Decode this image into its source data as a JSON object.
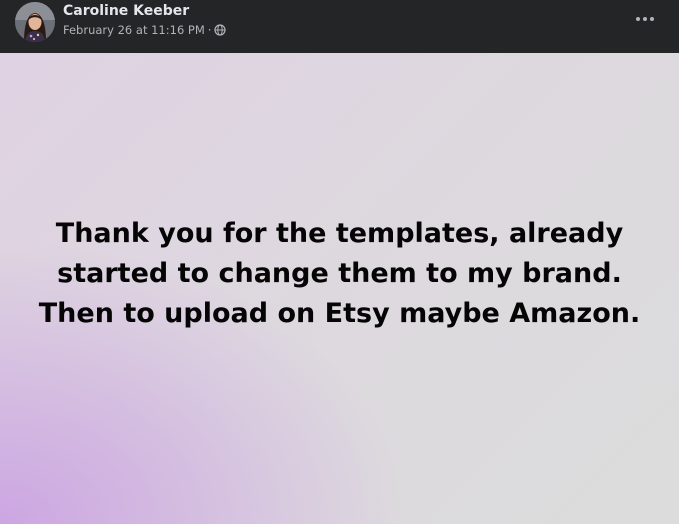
{
  "post": {
    "author": "Caroline Keeber",
    "timestamp": "February 26 at 11:16 PM",
    "separator": "·",
    "audience_icon": "globe-icon",
    "more_icon": "more-horizontal-icon",
    "more_label": "•••",
    "text": "Thank you for the templates, already started to change them to my brand. Then to upload on Etsy maybe Amazon.",
    "colors": {
      "header_bg": "#242526",
      "author_text": "#e4e6eb",
      "meta_text": "#b0b3b8",
      "body_text": "#050505",
      "gradient_purple": "#cca6e2",
      "gradient_grey": "#dcdcdc"
    }
  }
}
